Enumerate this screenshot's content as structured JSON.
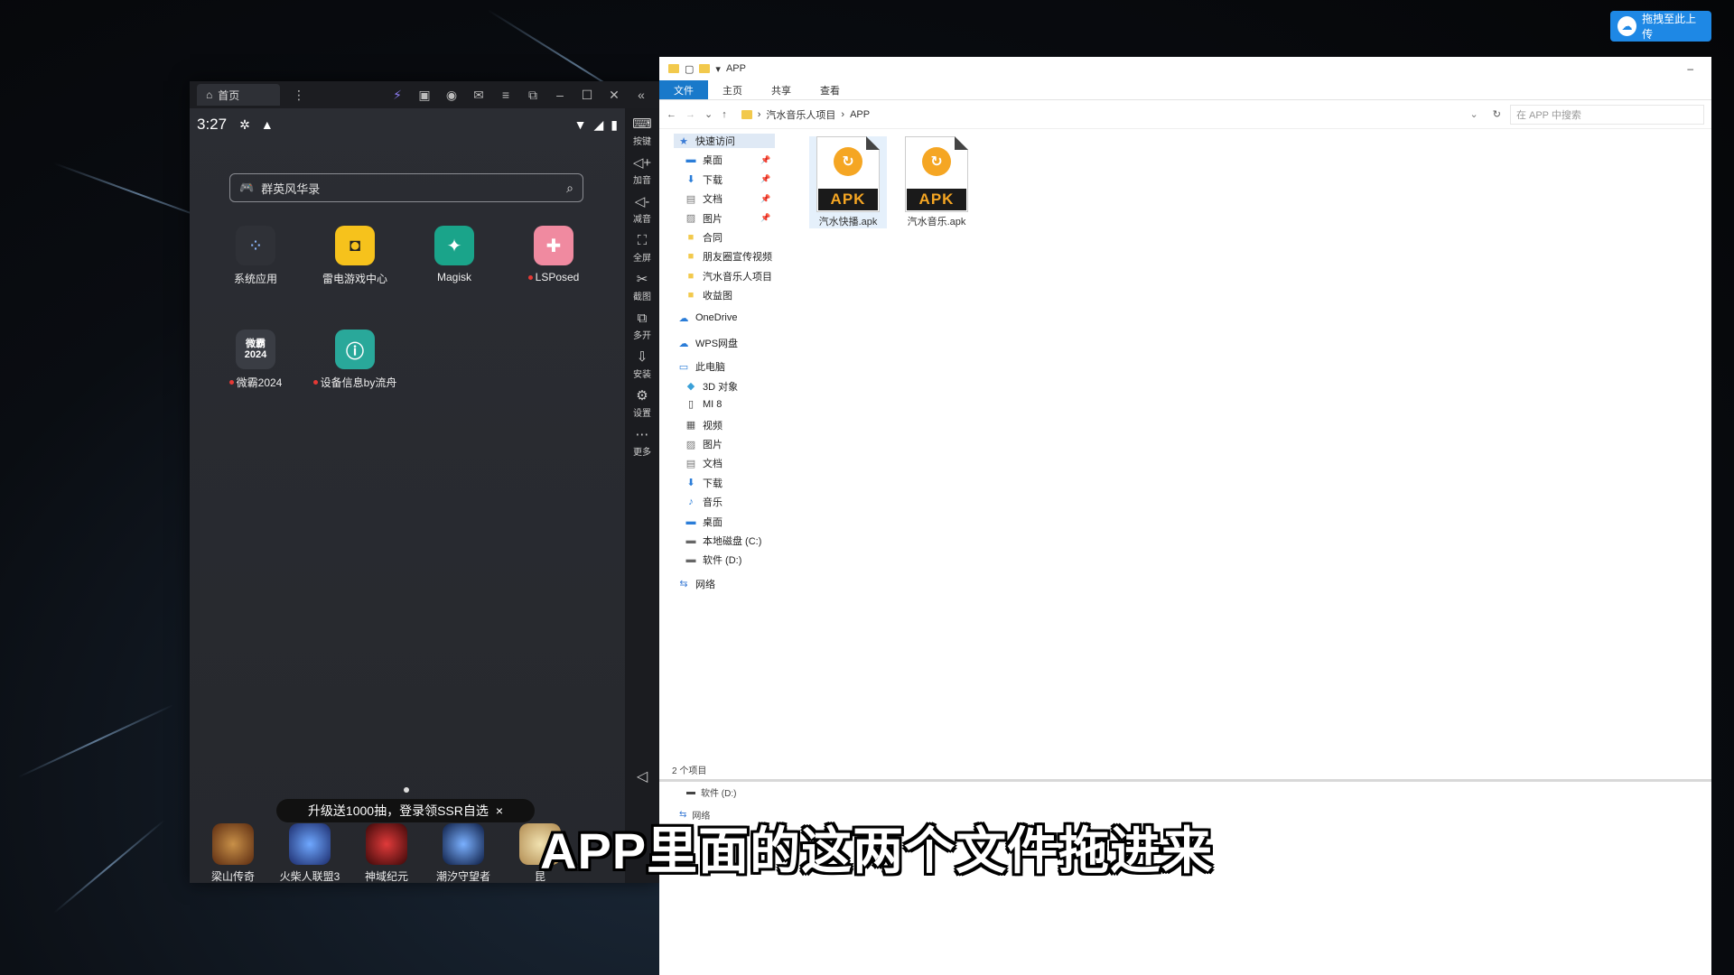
{
  "upload_button": {
    "label": "拖拽至此上传"
  },
  "emulator": {
    "tab_label": "首页",
    "status_time": "3:27",
    "search_text": "群英风华录",
    "sidebar": [
      "按键",
      "加音",
      "减音",
      "全屏",
      "截图",
      "多开",
      "安装",
      "设置",
      "更多"
    ],
    "apps": [
      {
        "label": "系统应用",
        "dot": false,
        "icon_text": "▪▪",
        "color": "#2f3137"
      },
      {
        "label": "雷电游戏中心",
        "dot": false,
        "icon_text": "🎮",
        "color": "#f6c21c"
      },
      {
        "label": "Magisk",
        "dot": false,
        "icon_text": "✦",
        "color": "#1aa48a"
      },
      {
        "label": "LSPosed",
        "dot": true,
        "icon_text": "✚",
        "color": "#f08aa0"
      },
      {
        "label": "微霸2024",
        "dot": true,
        "icon_text": "微霸 2024",
        "color": "#3a3d44"
      },
      {
        "label": "设备信息by流舟",
        "dot": true,
        "icon_text": "ⓘ",
        "color": "#29a89a"
      }
    ],
    "promo_text": "升级送1000抽，登录领SSR自选",
    "promo_close": "×",
    "dock": [
      "梁山传奇",
      "火柴人联盟3",
      "神域纪元",
      "潮汐守望者",
      "昆"
    ]
  },
  "explorer": {
    "title": "APP",
    "ribbon_tabs": [
      "文件",
      "主页",
      "共享",
      "查看"
    ],
    "breadcrumb": [
      "汽水音乐人项目",
      "APP"
    ],
    "search_placeholder": "在 APP 中搜索",
    "nav": [
      {
        "label": "快速访问",
        "icon": "star-icon",
        "pin": false,
        "selected": true,
        "indent": 1
      },
      {
        "label": "桌面",
        "icon": "desktop-icon",
        "pin": true,
        "indent": 2
      },
      {
        "label": "下载",
        "icon": "download-icon",
        "pin": true,
        "indent": 2
      },
      {
        "label": "文档",
        "icon": "document-icon",
        "pin": true,
        "indent": 2
      },
      {
        "label": "图片",
        "icon": "picture-icon",
        "pin": true,
        "indent": 2
      },
      {
        "label": "合同",
        "icon": "folder-icon",
        "pin": false,
        "indent": 2
      },
      {
        "label": "朋友圈宣传视频",
        "icon": "folder-icon",
        "pin": false,
        "indent": 2
      },
      {
        "label": "汽水音乐人项目",
        "icon": "folder-icon",
        "pin": false,
        "indent": 2
      },
      {
        "label": "收益图",
        "icon": "folder-icon",
        "pin": false,
        "indent": 2
      },
      {
        "label": "OneDrive",
        "icon": "cloud-icon",
        "pin": false,
        "indent": 1,
        "gap": true
      },
      {
        "label": "WPS网盘",
        "icon": "cloud-icon",
        "pin": false,
        "indent": 1,
        "gap": true
      },
      {
        "label": "此电脑",
        "icon": "computer-icon",
        "pin": false,
        "indent": 1,
        "gap": true
      },
      {
        "label": "3D 对象",
        "icon": "cube-icon",
        "pin": false,
        "indent": 2
      },
      {
        "label": "MI 8",
        "icon": "phone-icon",
        "pin": false,
        "indent": 2
      },
      {
        "label": "视频",
        "icon": "video-icon",
        "pin": false,
        "indent": 2
      },
      {
        "label": "图片",
        "icon": "picture-icon",
        "pin": false,
        "indent": 2
      },
      {
        "label": "文档",
        "icon": "document-icon",
        "pin": false,
        "indent": 2
      },
      {
        "label": "下载",
        "icon": "download-icon",
        "pin": false,
        "indent": 2
      },
      {
        "label": "音乐",
        "icon": "music-icon",
        "pin": false,
        "indent": 2
      },
      {
        "label": "桌面",
        "icon": "desktop-icon",
        "pin": false,
        "indent": 2
      },
      {
        "label": "本地磁盘 (C:)",
        "icon": "drive-icon",
        "pin": false,
        "indent": 2
      },
      {
        "label": "软件 (D:)",
        "icon": "drive-icon",
        "pin": false,
        "indent": 2
      },
      {
        "label": "网络",
        "icon": "network-icon",
        "pin": false,
        "indent": 1,
        "gap": true
      }
    ],
    "files": [
      {
        "name": "汽水快播.apk",
        "badge": "APK",
        "selected": true
      },
      {
        "name": "汽水音乐.apk",
        "badge": "APK",
        "selected": false
      }
    ],
    "status": "2 个项目",
    "ghost_rows": [
      "软件 (D:)",
      "网络"
    ]
  },
  "subtitle": "APP里面的这两个文件拖进来"
}
